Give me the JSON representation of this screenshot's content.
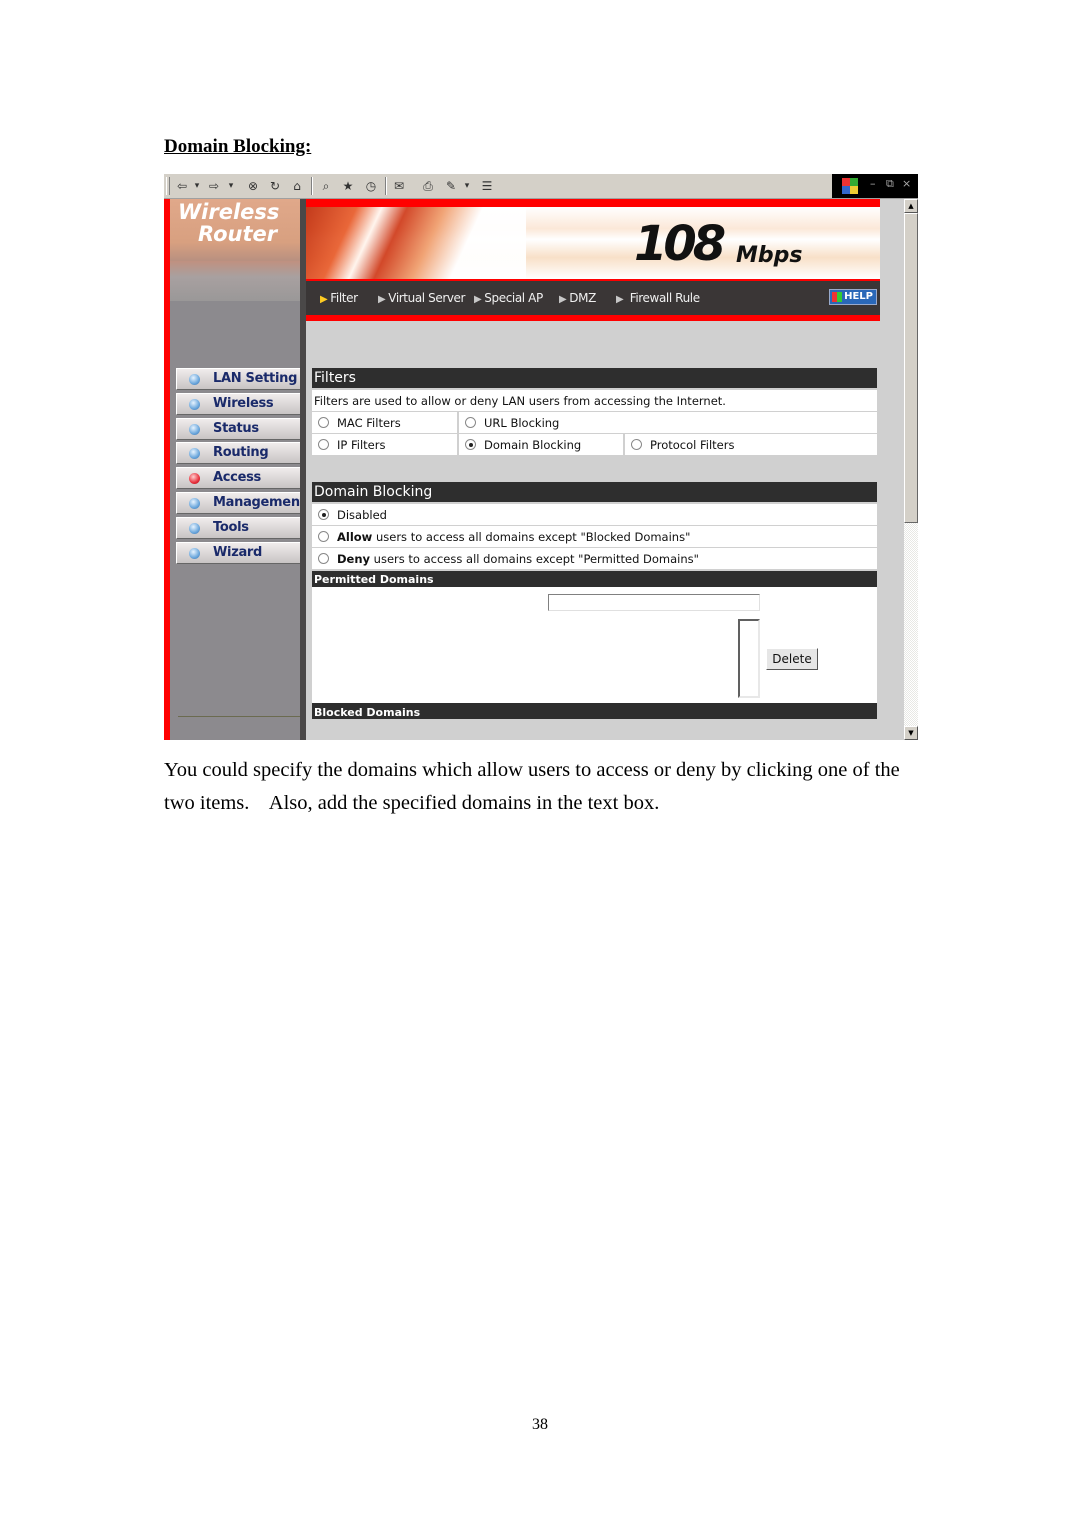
{
  "document": {
    "heading": "Domain Blocking:",
    "body_text": "You could specify the domains which allow users to access or deny by clicking one of the two items.    Also, add the specified domains in the text box.",
    "page_number": "38"
  },
  "browser": {
    "toolbar_icons": [
      "back-icon",
      "dropdown-arrow-icon",
      "forward-icon",
      "dropdown-arrow-icon",
      "stop-icon",
      "refresh-icon",
      "home-icon",
      "search-icon",
      "favorites-icon",
      "history-icon",
      "mail-icon",
      "print-icon",
      "edit-icon",
      "discuss-icon"
    ],
    "toolbar_glyphs": {
      "back": "⇦",
      "back_drop": "▾",
      "forward": "⇨",
      "forward_drop": "▾",
      "stop": "⊗",
      "refresh": "↻",
      "home": "⌂",
      "search": "⌕",
      "favorites": "★",
      "history": "◷",
      "mail": "✉",
      "print": "⎙",
      "edit": "✎",
      "edit_drop": "▾",
      "discuss": "☰"
    },
    "window_controls": {
      "minimize": "–",
      "restore": "⧉",
      "close": "×"
    },
    "scroll": {
      "up": "▲",
      "down": "▼"
    }
  },
  "router": {
    "logo_line1": "Wireless",
    "logo_line2": "Router",
    "banner_speed": "108",
    "banner_unit": "Mbps",
    "menu": [
      {
        "label": "Filter",
        "active": true
      },
      {
        "label": "Virtual Server",
        "active": false
      },
      {
        "label": "Special AP",
        "active": false
      },
      {
        "label": "DMZ",
        "active": false
      },
      {
        "label": "Firewall Rule",
        "active": false
      }
    ],
    "help_label": "HELP",
    "sidebar": [
      {
        "label": "LAN Setting",
        "active": false
      },
      {
        "label": "Wireless",
        "active": false
      },
      {
        "label": "Status",
        "active": false
      },
      {
        "label": "Routing",
        "active": false
      },
      {
        "label": "Access",
        "active": true
      },
      {
        "label": "Management",
        "active": false
      },
      {
        "label": "Tools",
        "active": false
      },
      {
        "label": "Wizard",
        "active": false
      }
    ],
    "filters": {
      "title": "Filters",
      "description": "Filters are used to allow or deny LAN users from accessing the Internet.",
      "options": [
        {
          "label": "MAC Filters",
          "selected": false
        },
        {
          "label": "URL Blocking",
          "selected": false
        },
        {
          "label": "IP Filters",
          "selected": false
        },
        {
          "label": "Domain Blocking",
          "selected": true
        },
        {
          "label": "Protocol Filters",
          "selected": false
        }
      ]
    },
    "domain_blocking": {
      "title": "Domain Blocking",
      "options": [
        {
          "bold": "",
          "label": "Disabled",
          "selected": true
        },
        {
          "bold": "Allow",
          "label": " users to access all domains except \"Blocked Domains\"",
          "selected": false
        },
        {
          "bold": "Deny",
          "label": " users to access all domains except \"Permitted Domains\"",
          "selected": false
        }
      ],
      "permitted_title": "Permitted Domains",
      "permitted_input_value": "",
      "delete_label": "Delete",
      "blocked_title": "Blocked Domains"
    }
  }
}
